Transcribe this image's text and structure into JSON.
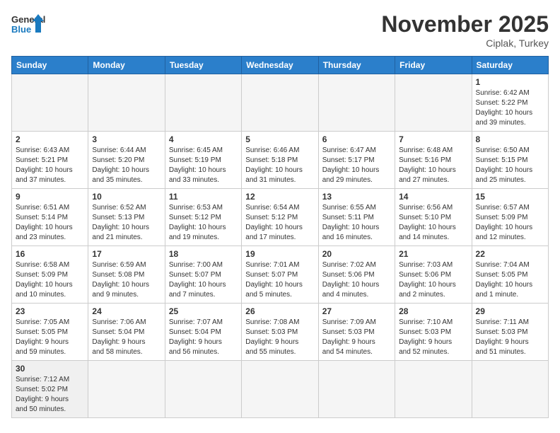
{
  "header": {
    "logo_general": "General",
    "logo_blue": "Blue",
    "month_year": "November 2025",
    "location": "Ciplak, Turkey"
  },
  "days_of_week": [
    "Sunday",
    "Monday",
    "Tuesday",
    "Wednesday",
    "Thursday",
    "Friday",
    "Saturday"
  ],
  "weeks": [
    {
      "days": [
        {
          "date": "",
          "info": ""
        },
        {
          "date": "",
          "info": ""
        },
        {
          "date": "",
          "info": ""
        },
        {
          "date": "",
          "info": ""
        },
        {
          "date": "",
          "info": ""
        },
        {
          "date": "",
          "info": ""
        },
        {
          "date": "1",
          "info": "Sunrise: 6:42 AM\nSunset: 5:22 PM\nDaylight: 10 hours\nand 39 minutes."
        }
      ]
    },
    {
      "days": [
        {
          "date": "2",
          "info": "Sunrise: 6:43 AM\nSunset: 5:21 PM\nDaylight: 10 hours\nand 37 minutes."
        },
        {
          "date": "3",
          "info": "Sunrise: 6:44 AM\nSunset: 5:20 PM\nDaylight: 10 hours\nand 35 minutes."
        },
        {
          "date": "4",
          "info": "Sunrise: 6:45 AM\nSunset: 5:19 PM\nDaylight: 10 hours\nand 33 minutes."
        },
        {
          "date": "5",
          "info": "Sunrise: 6:46 AM\nSunset: 5:18 PM\nDaylight: 10 hours\nand 31 minutes."
        },
        {
          "date": "6",
          "info": "Sunrise: 6:47 AM\nSunset: 5:17 PM\nDaylight: 10 hours\nand 29 minutes."
        },
        {
          "date": "7",
          "info": "Sunrise: 6:48 AM\nSunset: 5:16 PM\nDaylight: 10 hours\nand 27 minutes."
        },
        {
          "date": "8",
          "info": "Sunrise: 6:50 AM\nSunset: 5:15 PM\nDaylight: 10 hours\nand 25 minutes."
        }
      ]
    },
    {
      "days": [
        {
          "date": "9",
          "info": "Sunrise: 6:51 AM\nSunset: 5:14 PM\nDaylight: 10 hours\nand 23 minutes."
        },
        {
          "date": "10",
          "info": "Sunrise: 6:52 AM\nSunset: 5:13 PM\nDaylight: 10 hours\nand 21 minutes."
        },
        {
          "date": "11",
          "info": "Sunrise: 6:53 AM\nSunset: 5:12 PM\nDaylight: 10 hours\nand 19 minutes."
        },
        {
          "date": "12",
          "info": "Sunrise: 6:54 AM\nSunset: 5:12 PM\nDaylight: 10 hours\nand 17 minutes."
        },
        {
          "date": "13",
          "info": "Sunrise: 6:55 AM\nSunset: 5:11 PM\nDaylight: 10 hours\nand 16 minutes."
        },
        {
          "date": "14",
          "info": "Sunrise: 6:56 AM\nSunset: 5:10 PM\nDaylight: 10 hours\nand 14 minutes."
        },
        {
          "date": "15",
          "info": "Sunrise: 6:57 AM\nSunset: 5:09 PM\nDaylight: 10 hours\nand 12 minutes."
        }
      ]
    },
    {
      "days": [
        {
          "date": "16",
          "info": "Sunrise: 6:58 AM\nSunset: 5:09 PM\nDaylight: 10 hours\nand 10 minutes."
        },
        {
          "date": "17",
          "info": "Sunrise: 6:59 AM\nSunset: 5:08 PM\nDaylight: 10 hours\nand 9 minutes."
        },
        {
          "date": "18",
          "info": "Sunrise: 7:00 AM\nSunset: 5:07 PM\nDaylight: 10 hours\nand 7 minutes."
        },
        {
          "date": "19",
          "info": "Sunrise: 7:01 AM\nSunset: 5:07 PM\nDaylight: 10 hours\nand 5 minutes."
        },
        {
          "date": "20",
          "info": "Sunrise: 7:02 AM\nSunset: 5:06 PM\nDaylight: 10 hours\nand 4 minutes."
        },
        {
          "date": "21",
          "info": "Sunrise: 7:03 AM\nSunset: 5:06 PM\nDaylight: 10 hours\nand 2 minutes."
        },
        {
          "date": "22",
          "info": "Sunrise: 7:04 AM\nSunset: 5:05 PM\nDaylight: 10 hours\nand 1 minute."
        }
      ]
    },
    {
      "days": [
        {
          "date": "23",
          "info": "Sunrise: 7:05 AM\nSunset: 5:05 PM\nDaylight: 9 hours\nand 59 minutes."
        },
        {
          "date": "24",
          "info": "Sunrise: 7:06 AM\nSunset: 5:04 PM\nDaylight: 9 hours\nand 58 minutes."
        },
        {
          "date": "25",
          "info": "Sunrise: 7:07 AM\nSunset: 5:04 PM\nDaylight: 9 hours\nand 56 minutes."
        },
        {
          "date": "26",
          "info": "Sunrise: 7:08 AM\nSunset: 5:03 PM\nDaylight: 9 hours\nand 55 minutes."
        },
        {
          "date": "27",
          "info": "Sunrise: 7:09 AM\nSunset: 5:03 PM\nDaylight: 9 hours\nand 54 minutes."
        },
        {
          "date": "28",
          "info": "Sunrise: 7:10 AM\nSunset: 5:03 PM\nDaylight: 9 hours\nand 52 minutes."
        },
        {
          "date": "29",
          "info": "Sunrise: 7:11 AM\nSunset: 5:03 PM\nDaylight: 9 hours\nand 51 minutes."
        }
      ]
    },
    {
      "days": [
        {
          "date": "30",
          "info": "Sunrise: 7:12 AM\nSunset: 5:02 PM\nDaylight: 9 hours\nand 50 minutes."
        },
        {
          "date": "",
          "info": ""
        },
        {
          "date": "",
          "info": ""
        },
        {
          "date": "",
          "info": ""
        },
        {
          "date": "",
          "info": ""
        },
        {
          "date": "",
          "info": ""
        },
        {
          "date": "",
          "info": ""
        }
      ]
    }
  ]
}
